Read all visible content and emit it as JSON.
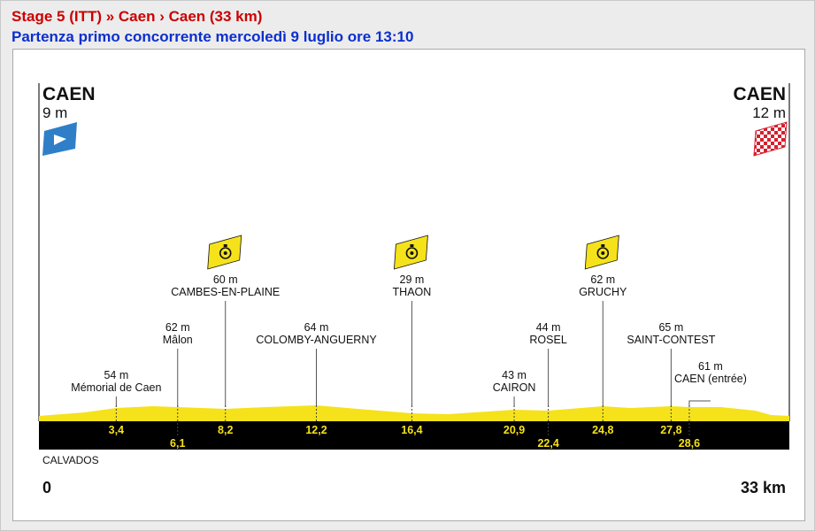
{
  "header": {
    "stage_line": "Stage 5 (ITT) » Caen › Caen (33 km)",
    "start_line": "Partenza primo concorrente mercoledì 9 luglio ore 13:10"
  },
  "profile": {
    "start": {
      "city": "CAEN",
      "altitude": "9 m",
      "icon": "start-flag-icon"
    },
    "finish": {
      "city": "CAEN",
      "altitude": "12 m",
      "icon": "finish-flag-icon"
    },
    "region": "CALVADOS",
    "km_start": "0",
    "km_end": "33 km",
    "total_km": 33,
    "waypoints": [
      {
        "km": 3.4,
        "km_label": "3,4",
        "name": "Mémorial de Caen",
        "alt": "54 m",
        "timecheck": false
      },
      {
        "km": 6.1,
        "km_label": "6,1",
        "name": "Mâlon",
        "alt": "62 m",
        "timecheck": false
      },
      {
        "km": 8.2,
        "km_label": "8,2",
        "name": "CAMBES-EN-PLAINE",
        "alt": "60 m",
        "timecheck": true
      },
      {
        "km": 12.2,
        "km_label": "12,2",
        "name": "COLOMBY-ANGUERNY",
        "alt": "64 m",
        "timecheck": false
      },
      {
        "km": 16.4,
        "km_label": "16,4",
        "name": "THAON",
        "alt": "29 m",
        "timecheck": true
      },
      {
        "km": 20.9,
        "km_label": "20,9",
        "name": "CAIRON",
        "alt": "43 m",
        "timecheck": false
      },
      {
        "km": 22.4,
        "km_label": "22,4",
        "name": "ROSEL",
        "alt": "44 m",
        "timecheck": false
      },
      {
        "km": 24.8,
        "km_label": "24,8",
        "name": "GRUCHY",
        "alt": "62 m",
        "timecheck": true
      },
      {
        "km": 27.8,
        "km_label": "27,8",
        "name": "SAINT-CONTEST",
        "alt": "65 m",
        "timecheck": false
      },
      {
        "km": 28.6,
        "km_label": "28,6",
        "name": "CAEN (entrée)",
        "alt": "61 m",
        "timecheck": false
      }
    ],
    "colors": {
      "profile_fill": "#f5e21a",
      "ground": "#000000",
      "km_text": "#f5e21a",
      "start_flag": "#2f7fc8",
      "finish_flag": "#d6202f"
    }
  }
}
